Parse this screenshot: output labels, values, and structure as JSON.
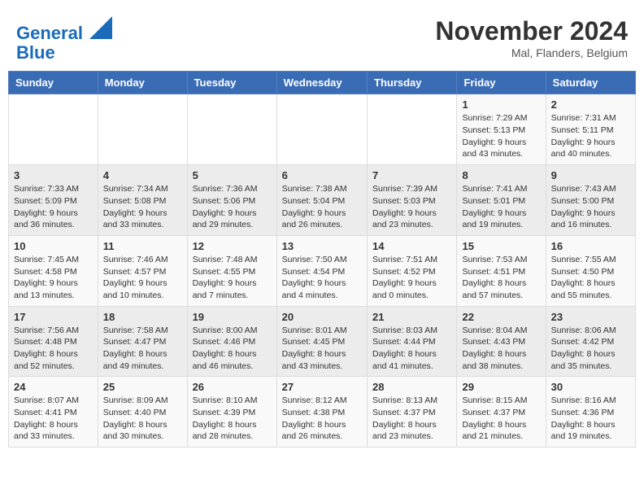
{
  "header": {
    "logo_line1": "General",
    "logo_line2": "Blue",
    "month": "November 2024",
    "location": "Mal, Flanders, Belgium"
  },
  "weekdays": [
    "Sunday",
    "Monday",
    "Tuesday",
    "Wednesday",
    "Thursday",
    "Friday",
    "Saturday"
  ],
  "weeks": [
    [
      {
        "day": "",
        "info": ""
      },
      {
        "day": "",
        "info": ""
      },
      {
        "day": "",
        "info": ""
      },
      {
        "day": "",
        "info": ""
      },
      {
        "day": "",
        "info": ""
      },
      {
        "day": "1",
        "info": "Sunrise: 7:29 AM\nSunset: 5:13 PM\nDaylight: 9 hours and 43 minutes."
      },
      {
        "day": "2",
        "info": "Sunrise: 7:31 AM\nSunset: 5:11 PM\nDaylight: 9 hours and 40 minutes."
      }
    ],
    [
      {
        "day": "3",
        "info": "Sunrise: 7:33 AM\nSunset: 5:09 PM\nDaylight: 9 hours and 36 minutes."
      },
      {
        "day": "4",
        "info": "Sunrise: 7:34 AM\nSunset: 5:08 PM\nDaylight: 9 hours and 33 minutes."
      },
      {
        "day": "5",
        "info": "Sunrise: 7:36 AM\nSunset: 5:06 PM\nDaylight: 9 hours and 29 minutes."
      },
      {
        "day": "6",
        "info": "Sunrise: 7:38 AM\nSunset: 5:04 PM\nDaylight: 9 hours and 26 minutes."
      },
      {
        "day": "7",
        "info": "Sunrise: 7:39 AM\nSunset: 5:03 PM\nDaylight: 9 hours and 23 minutes."
      },
      {
        "day": "8",
        "info": "Sunrise: 7:41 AM\nSunset: 5:01 PM\nDaylight: 9 hours and 19 minutes."
      },
      {
        "day": "9",
        "info": "Sunrise: 7:43 AM\nSunset: 5:00 PM\nDaylight: 9 hours and 16 minutes."
      }
    ],
    [
      {
        "day": "10",
        "info": "Sunrise: 7:45 AM\nSunset: 4:58 PM\nDaylight: 9 hours and 13 minutes."
      },
      {
        "day": "11",
        "info": "Sunrise: 7:46 AM\nSunset: 4:57 PM\nDaylight: 9 hours and 10 minutes."
      },
      {
        "day": "12",
        "info": "Sunrise: 7:48 AM\nSunset: 4:55 PM\nDaylight: 9 hours and 7 minutes."
      },
      {
        "day": "13",
        "info": "Sunrise: 7:50 AM\nSunset: 4:54 PM\nDaylight: 9 hours and 4 minutes."
      },
      {
        "day": "14",
        "info": "Sunrise: 7:51 AM\nSunset: 4:52 PM\nDaylight: 9 hours and 0 minutes."
      },
      {
        "day": "15",
        "info": "Sunrise: 7:53 AM\nSunset: 4:51 PM\nDaylight: 8 hours and 57 minutes."
      },
      {
        "day": "16",
        "info": "Sunrise: 7:55 AM\nSunset: 4:50 PM\nDaylight: 8 hours and 55 minutes."
      }
    ],
    [
      {
        "day": "17",
        "info": "Sunrise: 7:56 AM\nSunset: 4:48 PM\nDaylight: 8 hours and 52 minutes."
      },
      {
        "day": "18",
        "info": "Sunrise: 7:58 AM\nSunset: 4:47 PM\nDaylight: 8 hours and 49 minutes."
      },
      {
        "day": "19",
        "info": "Sunrise: 8:00 AM\nSunset: 4:46 PM\nDaylight: 8 hours and 46 minutes."
      },
      {
        "day": "20",
        "info": "Sunrise: 8:01 AM\nSunset: 4:45 PM\nDaylight: 8 hours and 43 minutes."
      },
      {
        "day": "21",
        "info": "Sunrise: 8:03 AM\nSunset: 4:44 PM\nDaylight: 8 hours and 41 minutes."
      },
      {
        "day": "22",
        "info": "Sunrise: 8:04 AM\nSunset: 4:43 PM\nDaylight: 8 hours and 38 minutes."
      },
      {
        "day": "23",
        "info": "Sunrise: 8:06 AM\nSunset: 4:42 PM\nDaylight: 8 hours and 35 minutes."
      }
    ],
    [
      {
        "day": "24",
        "info": "Sunrise: 8:07 AM\nSunset: 4:41 PM\nDaylight: 8 hours and 33 minutes."
      },
      {
        "day": "25",
        "info": "Sunrise: 8:09 AM\nSunset: 4:40 PM\nDaylight: 8 hours and 30 minutes."
      },
      {
        "day": "26",
        "info": "Sunrise: 8:10 AM\nSunset: 4:39 PM\nDaylight: 8 hours and 28 minutes."
      },
      {
        "day": "27",
        "info": "Sunrise: 8:12 AM\nSunset: 4:38 PM\nDaylight: 8 hours and 26 minutes."
      },
      {
        "day": "28",
        "info": "Sunrise: 8:13 AM\nSunset: 4:37 PM\nDaylight: 8 hours and 23 minutes."
      },
      {
        "day": "29",
        "info": "Sunrise: 8:15 AM\nSunset: 4:37 PM\nDaylight: 8 hours and 21 minutes."
      },
      {
        "day": "30",
        "info": "Sunrise: 8:16 AM\nSunset: 4:36 PM\nDaylight: 8 hours and 19 minutes."
      }
    ]
  ]
}
